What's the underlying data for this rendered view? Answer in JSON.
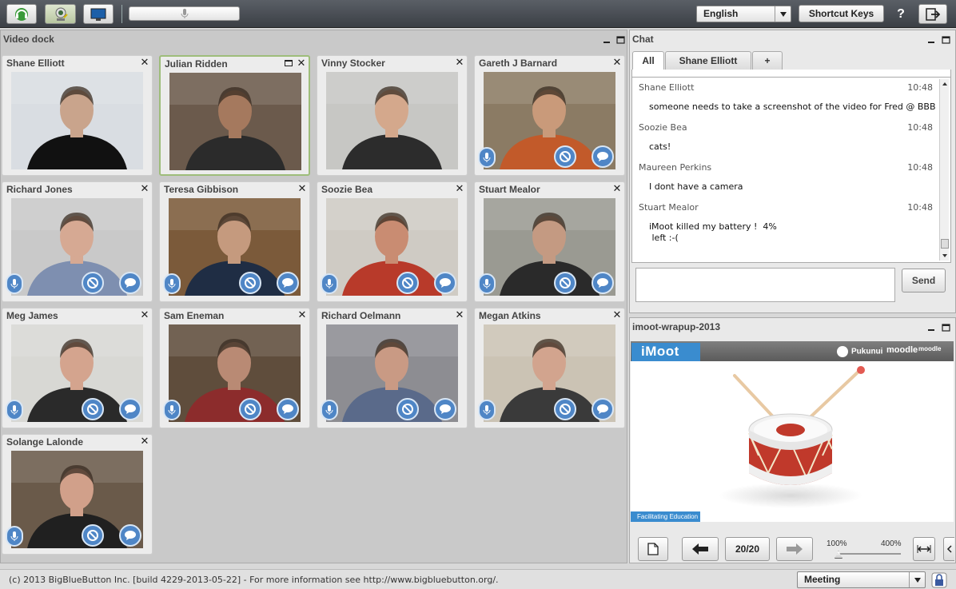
{
  "toolbar": {
    "language": "English",
    "shortcut_keys": "Shortcut Keys",
    "help": "?"
  },
  "video_dock": {
    "title": "Video dock",
    "participants": [
      {
        "name": "Shane Elliott",
        "skin": "#c9a48c",
        "bg": "#d9dde2",
        "shirt": "#111111",
        "controls": false,
        "active": false
      },
      {
        "name": "Julian Ridden",
        "skin": "#a5795e",
        "bg": "#6b5a4c",
        "shirt": "#2b2b2b",
        "controls": false,
        "active": true
      },
      {
        "name": "Vinny Stocker",
        "skin": "#d4a88c",
        "bg": "#c7c7c4",
        "shirt": "#2c2c2c",
        "controls": false,
        "active": false
      },
      {
        "name": "Gareth J Barnard",
        "skin": "#c99a7a",
        "bg": "#8b7b64",
        "shirt": "#c25a2a",
        "controls": true,
        "active": false
      },
      {
        "name": "Richard Jones",
        "skin": "#d6a993",
        "bg": "#c9c9c9",
        "shirt": "#7e8fb0",
        "controls": true,
        "active": false
      },
      {
        "name": "Teresa Gibbison",
        "skin": "#c59a7e",
        "bg": "#7b5a3a",
        "shirt": "#1f2d44",
        "controls": true,
        "active": false
      },
      {
        "name": "Soozie Bea",
        "skin": "#c98c72",
        "bg": "#cfcbc4",
        "shirt": "#b83a2a",
        "controls": true,
        "active": false
      },
      {
        "name": "Stuart Mealor",
        "skin": "#c49a82",
        "bg": "#9a9a92",
        "shirt": "#2a2a2a",
        "controls": true,
        "active": false
      },
      {
        "name": "Meg James",
        "skin": "#d4a48e",
        "bg": "#d8d8d4",
        "shirt": "#2a2a2a",
        "controls": true,
        "active": false
      },
      {
        "name": "Sam Eneman",
        "skin": "#b98a74",
        "bg": "#5f4d3c",
        "shirt": "#8c2c2c",
        "controls": true,
        "active": false
      },
      {
        "name": "Richard Oelmann",
        "skin": "#c99a84",
        "bg": "#8d8d92",
        "shirt": "#5a6a8a",
        "controls": true,
        "active": false
      },
      {
        "name": "Megan Atkins",
        "skin": "#d2a48e",
        "bg": "#cbc3b4",
        "shirt": "#3a3a3a",
        "controls": true,
        "active": false
      },
      {
        "name": "Solange Lalonde",
        "skin": "#d1a08a",
        "bg": "#6a5a4a",
        "shirt": "#202020",
        "controls": true,
        "active": false
      }
    ]
  },
  "chat": {
    "title": "Chat",
    "tabs": [
      "All",
      "Shane Elliott",
      "+"
    ],
    "messages": [
      {
        "sender": "Shane Elliott",
        "time": "10:48",
        "text": "someone needs to take a screenshot of the video for Fred @ BBB"
      },
      {
        "sender": "Soozie Bea",
        "time": "10:48",
        "text": "cats!"
      },
      {
        "sender": "Maureen Perkins",
        "time": "10:48",
        "text": "I dont have a camera"
      },
      {
        "sender": "Stuart Mealor",
        "time": "10:48",
        "text": "iMoot killed my battery !  4%\n left :-("
      }
    ],
    "input_value": "",
    "send_label": "Send"
  },
  "presentation": {
    "title": "imoot-wrapup-2013",
    "logo_text": "iMoot",
    "sponsors": [
      "Pukunui",
      "moodle",
      "moodle"
    ],
    "footer_text": "Facilitating Education",
    "page": "20/20",
    "zoom_min": "100%",
    "zoom_max": "400%"
  },
  "footer": {
    "copyright": "(c) 2013 BigBlueButton Inc. [build 4229-2013-05-22] - For more information see http://www.bigbluebutton.org/.",
    "layout": "Meeting"
  },
  "colors": {
    "accent_blue": "#4f86c6",
    "topbar": "#3b3f45",
    "active_border": "#9ebd7a"
  }
}
